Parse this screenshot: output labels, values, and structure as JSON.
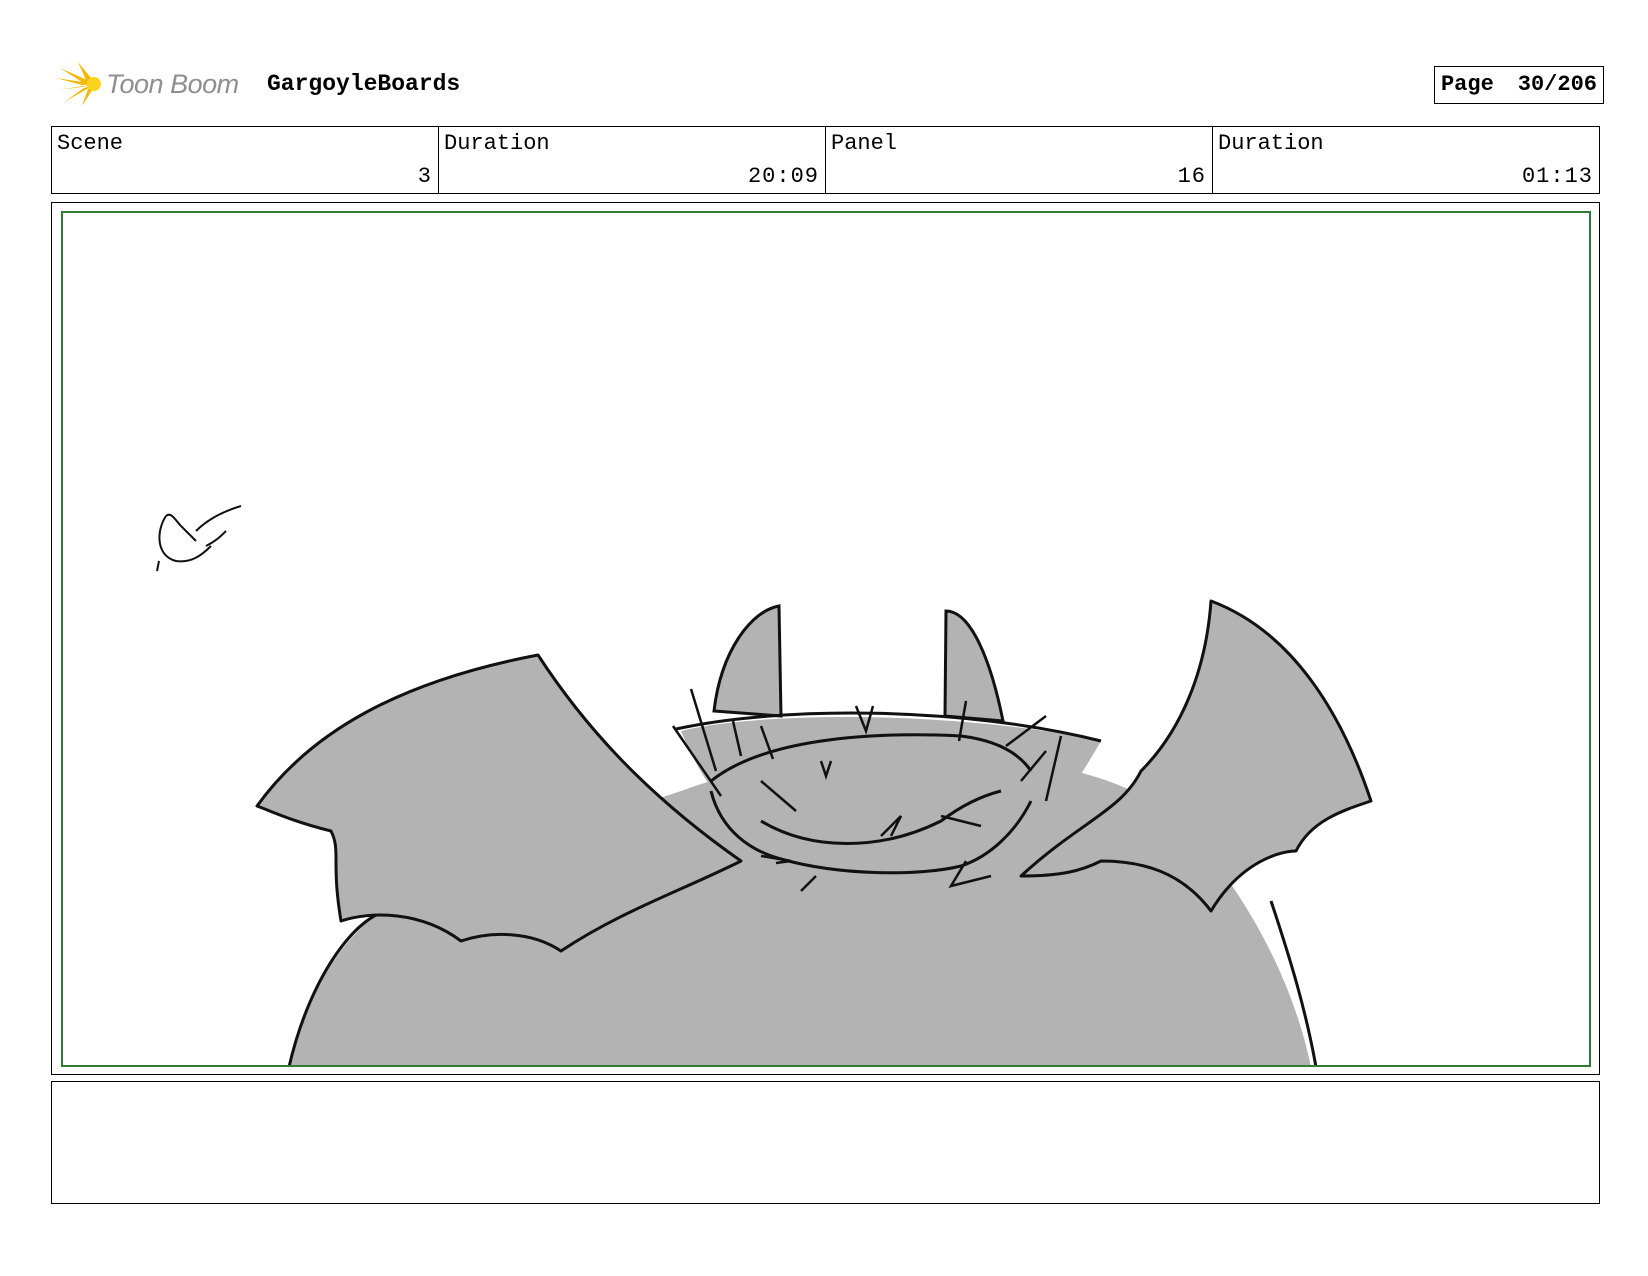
{
  "header": {
    "logo_text": "Toon Boom",
    "project_title": "GargoyleBoards",
    "page_label": "Page",
    "page_number": "30/206"
  },
  "info": {
    "scene_label": "Scene",
    "scene_value": "3",
    "scene_duration_label": "Duration",
    "scene_duration_value": "20:09",
    "panel_label": "Panel",
    "panel_value": "16",
    "panel_duration_label": "Duration",
    "panel_duration_value": "01:13"
  },
  "colors": {
    "safe_frame": "#2e7d32",
    "sketch_fill": "#b3b3b3",
    "logo_accent": "#f5b800"
  },
  "notes": {
    "text": ""
  }
}
